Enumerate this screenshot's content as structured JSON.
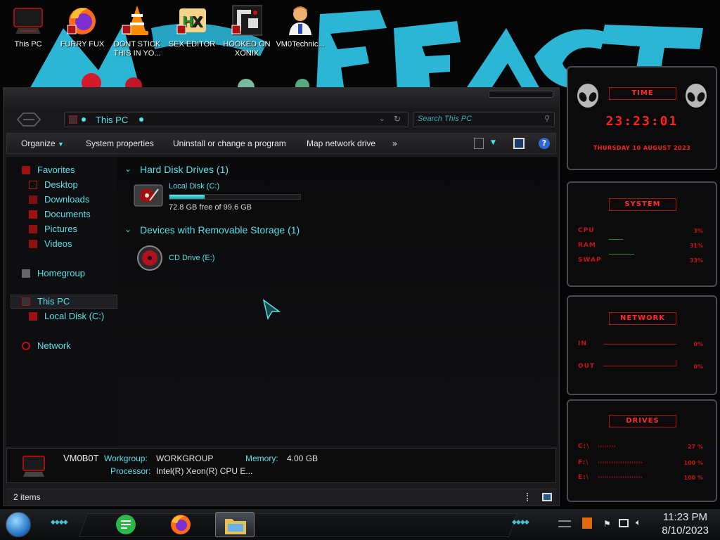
{
  "desktop": {
    "icons": [
      {
        "label": "This PC",
        "icon": "computer-icon"
      },
      {
        "label": "FURRY FUX",
        "icon": "firefox-icon"
      },
      {
        "label": "DONT STICK THIS IN YO...",
        "icon": "vlc-icon"
      },
      {
        "label": "SEX EDITOR",
        "icon": "hex-editor-icon"
      },
      {
        "label": "HOOKED ON XONIX",
        "icon": "xonix-game-icon"
      },
      {
        "label": "VM0Technic...",
        "icon": "technician-icon"
      }
    ]
  },
  "explorer": {
    "address": "This PC",
    "search_placeholder": "Search This PC",
    "toolbar": {
      "organize": "Organize",
      "system_properties": "System properties",
      "uninstall": "Uninstall or change a program",
      "map_drive": "Map network drive",
      "more": "»"
    },
    "nav": {
      "favorites": "Favorites",
      "desktop": "Desktop",
      "downloads": "Downloads",
      "documents": "Documents",
      "pictures": "Pictures",
      "videos": "Videos",
      "homegroup": "Homegroup",
      "this_pc": "This PC",
      "local_disk": "Local Disk (C:)",
      "network": "Network"
    },
    "groups": {
      "hdd_header": "Hard Disk Drives (1)",
      "removable_header": "Devices with Removable Storage (1)"
    },
    "drives": {
      "c_name": "Local Disk (C:)",
      "c_free": "72.8 GB free of 99.6 GB",
      "c_used_fraction": 0.269,
      "e_name": "CD Drive (E:)"
    },
    "details": {
      "computer_name": "VM0B0T",
      "workgroup_label": "Workgroup:",
      "workgroup_value": "WORKGROUP",
      "memory_label": "Memory:",
      "memory_value": "4.00 GB",
      "processor_label": "Processor:",
      "processor_value": "Intel(R) Xeon(R) CPU E..."
    },
    "status": {
      "items": "2 items"
    }
  },
  "widgets": {
    "time": {
      "title": "TIME",
      "clock": "23:23:01",
      "date": "THURSDAY 10 AUGUST 2023"
    },
    "system": {
      "title": "SYSTEM",
      "cpu_label": "CPU",
      "cpu_value": "3%",
      "ram_label": "RAM",
      "ram_value": "31%",
      "swap_label": "SWAP",
      "swap_value": "33%"
    },
    "network": {
      "title": "NETWORK",
      "in_label": "IN",
      "in_value": "0%",
      "out_label": "OUT",
      "out_value": "0%"
    },
    "drives": {
      "title": "DRIVES",
      "c_label": "C:\\",
      "c_value": "27 %",
      "f_label": "F:\\",
      "f_value": "100 %",
      "e_label": "E:\\",
      "e_value": "100 %"
    }
  },
  "taskbar": {
    "time": "11:23 PM",
    "date": "8/10/2023"
  },
  "colors": {
    "accent": "#55e0e8",
    "widget_red": "#c41414",
    "wallpaper_cyan": "#2bb6d6"
  }
}
